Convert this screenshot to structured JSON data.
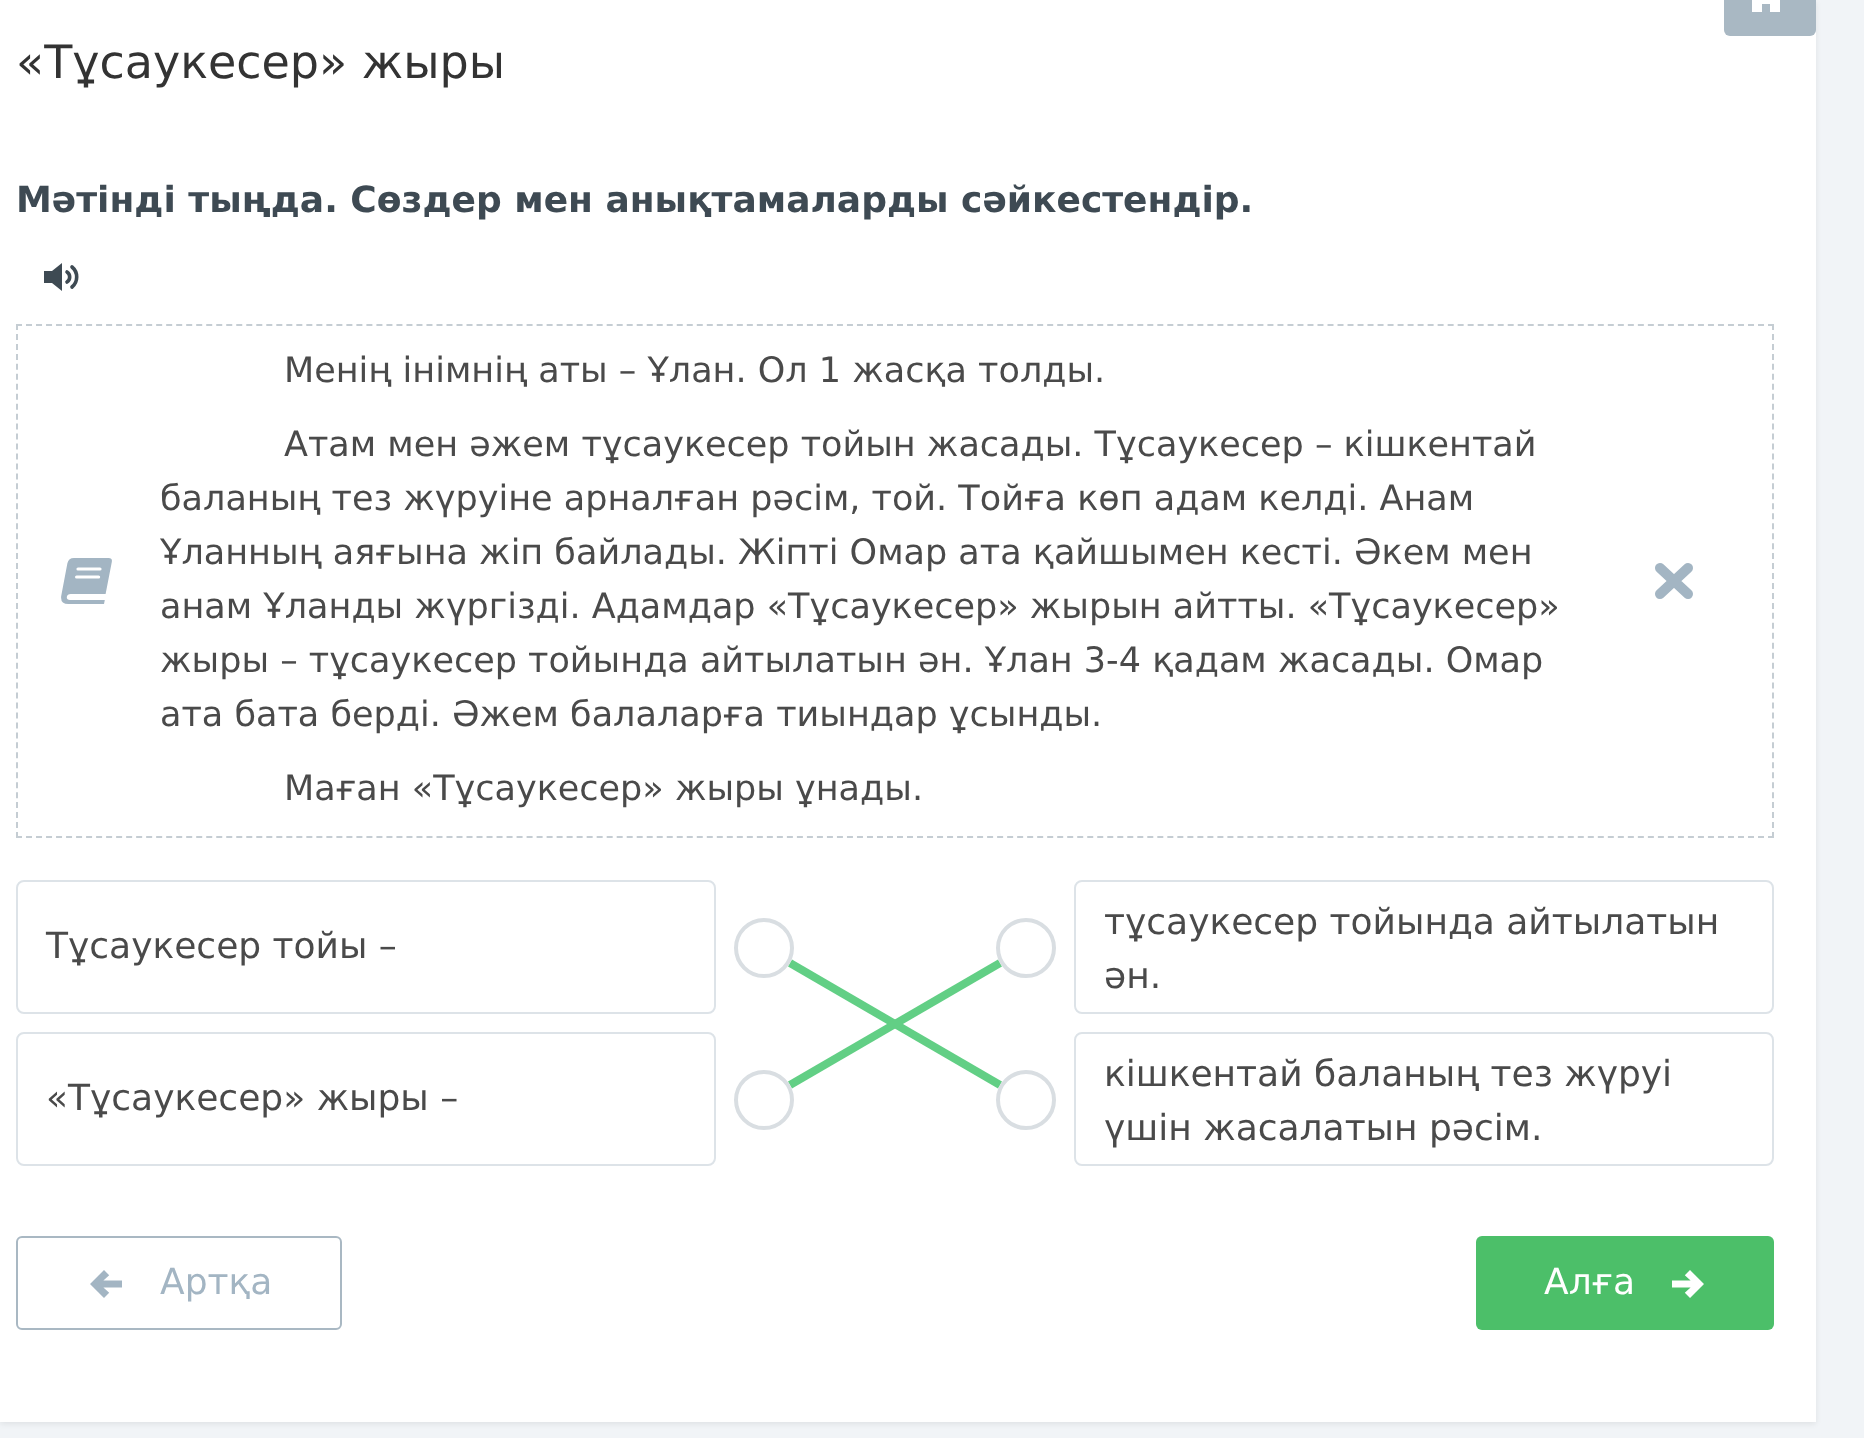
{
  "title": "«Тұсаукесер» жыры",
  "instruction": "Мәтінді тыңда. Сөздер мен анықтамаларды сәйкестендір.",
  "reading_text": {
    "paragraphs": [
      "Менің інімнің аты – Ұлан. Ол 1 жасқа толды.",
      "Атам мен әжем тұсаукесер тойын жасады. Тұсаукесер – кішкентай баланың тез жүруіне арналған рәсім, той. Тойға көп адам келді. Анам Ұланның аяғына жіп байлады. Жіпті Омар ата қайшымен кесті. Әкем мен анам Ұланды жүргізді. Адамдар «Тұсаукесер» жырын айтты. «Тұсаукесер» жыры – тұсаукесер тойында айтылатын ән. Ұлан 3-4 қадам жасады. Омар ата бата берді. Әжем балаларға тиындар ұсынды.",
      "Маған «Тұсаукесер» жыры ұнады."
    ]
  },
  "matching": {
    "left": [
      {
        "text": "Тұсаукесер тойы –"
      },
      {
        "text": "«Тұсаукесер» жыры –"
      }
    ],
    "right": [
      {
        "text": "тұсаукесер тойында айтылатын ән."
      },
      {
        "text": "кішкентай баланың тез жүруі үшін жасалатын рәсім."
      }
    ],
    "lines": [
      {
        "kind": "down"
      },
      {
        "kind": "up"
      }
    ]
  },
  "buttons": [
    {
      "label": "Артқа",
      "kind": "back"
    },
    {
      "label": "Алға",
      "kind": "next"
    }
  ]
}
